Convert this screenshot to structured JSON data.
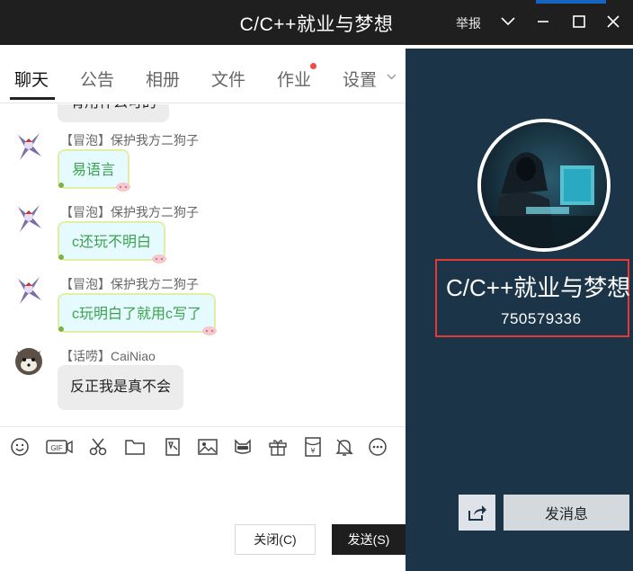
{
  "window": {
    "title": "C/C++就业与梦想",
    "report_label": "举报"
  },
  "tabs": [
    {
      "label": "聊天",
      "active": true
    },
    {
      "label": "公告"
    },
    {
      "label": "相册"
    },
    {
      "label": "文件"
    },
    {
      "label": "作业",
      "has_dot": true
    },
    {
      "label": "设置"
    }
  ],
  "chat": {
    "partial_top_text": "有用什么可的",
    "messages": [
      {
        "sender": "【冒泡】保护我方二狗子",
        "text": "易语言"
      },
      {
        "sender": "【冒泡】保护我方二狗子",
        "text": "c还玩不明白"
      },
      {
        "sender": "【冒泡】保护我方二狗子",
        "text": "c玩明白了就用c写了"
      },
      {
        "sender": "【话唠】CaiNiao",
        "text": "反正我是真不会"
      }
    ]
  },
  "toolbar": {
    "icons": [
      "emoji-icon",
      "gif-icon",
      "scissors-icon",
      "folder-icon",
      "sticker-icon",
      "image-icon",
      "mask-icon",
      "gift-icon",
      "red-packet-icon",
      "bell-icon",
      "more-icon"
    ]
  },
  "actions": {
    "close_label": "关闭(C)",
    "send_label": "发送(S)"
  },
  "group": {
    "name": "C/C++就业与梦想",
    "id": "750579336",
    "send_message_label": "发消息"
  },
  "colors": {
    "titlebar": "#1f1f1f",
    "panel": "#1b3448",
    "highlight": "#e53935",
    "bubble_text": "#3aa24a"
  }
}
